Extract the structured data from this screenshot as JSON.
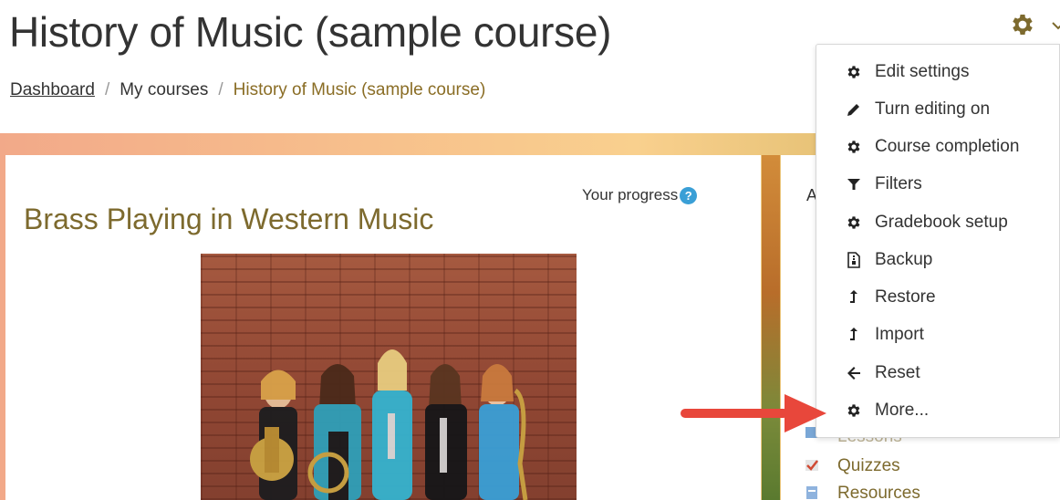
{
  "page": {
    "title": "History of Music (sample course)"
  },
  "breadcrumb": {
    "items": [
      "Dashboard",
      "My courses",
      "History of Music (sample course)"
    ],
    "separator": "/"
  },
  "main": {
    "progress_label": "Your progress",
    "help_icon": "question-circle-icon",
    "section_title": "Brass Playing in Western Music",
    "image": "course-photo"
  },
  "sidebar": {
    "heading_initial": "A",
    "links": [
      "Lessons",
      "Quizzes",
      "Resources"
    ]
  },
  "menu": {
    "items": [
      {
        "label": "Edit settings",
        "icon": "gear-icon"
      },
      {
        "label": "Turn editing on",
        "icon": "pencil-icon"
      },
      {
        "label": "Course completion",
        "icon": "gear-icon"
      },
      {
        "label": "Filters",
        "icon": "filter-icon"
      },
      {
        "label": "Gradebook setup",
        "icon": "gear-icon"
      },
      {
        "label": "Backup",
        "icon": "file-archive-icon"
      },
      {
        "label": "Restore",
        "icon": "level-up-icon"
      },
      {
        "label": "Import",
        "icon": "level-up-icon"
      },
      {
        "label": "Reset",
        "icon": "arrow-left-icon"
      },
      {
        "label": "More...",
        "icon": "gear-icon"
      }
    ]
  },
  "colors": {
    "accent_gold": "#8a6d25",
    "arrow_red": "#e8473b",
    "help_blue": "#3a9fd6"
  }
}
